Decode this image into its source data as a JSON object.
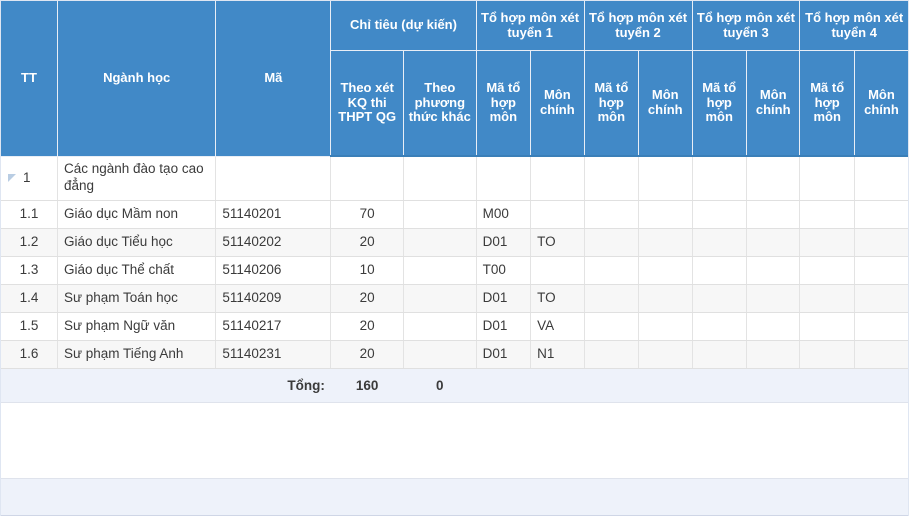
{
  "table": {
    "header": {
      "tt": "TT",
      "nganh_hoc": "Ngành học",
      "ma": "Mã",
      "chi_tieu_group": "Chỉ tiêu (dự kiến)",
      "theo_xet_kq": "Theo xét KQ thi THPT QG",
      "theo_phuong_thuc_khac": "Theo phương thức khác",
      "to_hop_1": "Tổ hợp môn xét tuyển 1",
      "to_hop_2": "Tổ hợp môn xét tuyển 2",
      "to_hop_3": "Tổ hợp môn xét tuyển 3",
      "to_hop_4": "Tổ hợp môn xét tuyển 4",
      "ma_to_hop_mon": "Mã tổ hợp môn",
      "mon_chinh": "Môn chính"
    },
    "rows": [
      {
        "tt": "1",
        "nganh_hoc": "Các ngành đào tạo cao đẳng",
        "ma": "",
        "theo_xet_kq": "",
        "theo_phuong_thuc_khac": "",
        "ma_th_1": "",
        "mon_chinh_1": "",
        "ma_th_2": "",
        "mon_chinh_2": "",
        "ma_th_3": "",
        "mon_chinh_3": "",
        "ma_th_4": "",
        "mon_chinh_4": "",
        "is_group": true
      },
      {
        "tt": "1.1",
        "nganh_hoc": "Giáo dục Mầm non",
        "ma": "51140201",
        "theo_xet_kq": "70",
        "theo_phuong_thuc_khac": "",
        "ma_th_1": "M00",
        "mon_chinh_1": "",
        "ma_th_2": "",
        "mon_chinh_2": "",
        "ma_th_3": "",
        "mon_chinh_3": "",
        "ma_th_4": "",
        "mon_chinh_4": "",
        "is_group": false
      },
      {
        "tt": "1.2",
        "nganh_hoc": "Giáo dục Tiểu học",
        "ma": "51140202",
        "theo_xet_kq": "20",
        "theo_phuong_thuc_khac": "",
        "ma_th_1": "D01",
        "mon_chinh_1": "TO",
        "ma_th_2": "",
        "mon_chinh_2": "",
        "ma_th_3": "",
        "mon_chinh_3": "",
        "ma_th_4": "",
        "mon_chinh_4": "",
        "is_group": false
      },
      {
        "tt": "1.3",
        "nganh_hoc": "Giáo dục Thể chất",
        "ma": "51140206",
        "theo_xet_kq": "10",
        "theo_phuong_thuc_khac": "",
        "ma_th_1": "T00",
        "mon_chinh_1": "",
        "ma_th_2": "",
        "mon_chinh_2": "",
        "ma_th_3": "",
        "mon_chinh_3": "",
        "ma_th_4": "",
        "mon_chinh_4": "",
        "is_group": false
      },
      {
        "tt": "1.4",
        "nganh_hoc": "Sư phạm Toán học",
        "ma": "51140209",
        "theo_xet_kq": "20",
        "theo_phuong_thuc_khac": "",
        "ma_th_1": "D01",
        "mon_chinh_1": "TO",
        "ma_th_2": "",
        "mon_chinh_2": "",
        "ma_th_3": "",
        "mon_chinh_3": "",
        "ma_th_4": "",
        "mon_chinh_4": "",
        "is_group": false
      },
      {
        "tt": "1.5",
        "nganh_hoc": "Sư phạm Ngữ văn",
        "ma": "51140217",
        "theo_xet_kq": "20",
        "theo_phuong_thuc_khac": "",
        "ma_th_1": "D01",
        "mon_chinh_1": "VA",
        "ma_th_2": "",
        "mon_chinh_2": "",
        "ma_th_3": "",
        "mon_chinh_3": "",
        "ma_th_4": "",
        "mon_chinh_4": "",
        "is_group": false
      },
      {
        "tt": "1.6",
        "nganh_hoc": "Sư phạm Tiếng Anh",
        "ma": "51140231",
        "theo_xet_kq": "20",
        "theo_phuong_thuc_khac": "",
        "ma_th_1": "D01",
        "mon_chinh_1": "N1",
        "ma_th_2": "",
        "mon_chinh_2": "",
        "ma_th_3": "",
        "mon_chinh_3": "",
        "ma_th_4": "",
        "mon_chinh_4": "",
        "is_group": false
      }
    ],
    "total": {
      "label": "Tổng:",
      "theo_xet_kq": "160",
      "theo_phuong_thuc_khac": "0"
    },
    "colors": {
      "header_blue": "#4189c7",
      "row_alt": "#f7f7f7",
      "total_bg": "#eef2fa",
      "tri_icon": "#b9cde3"
    },
    "icons": {
      "collapse_triangle": "triangle-collapse-icon"
    }
  }
}
